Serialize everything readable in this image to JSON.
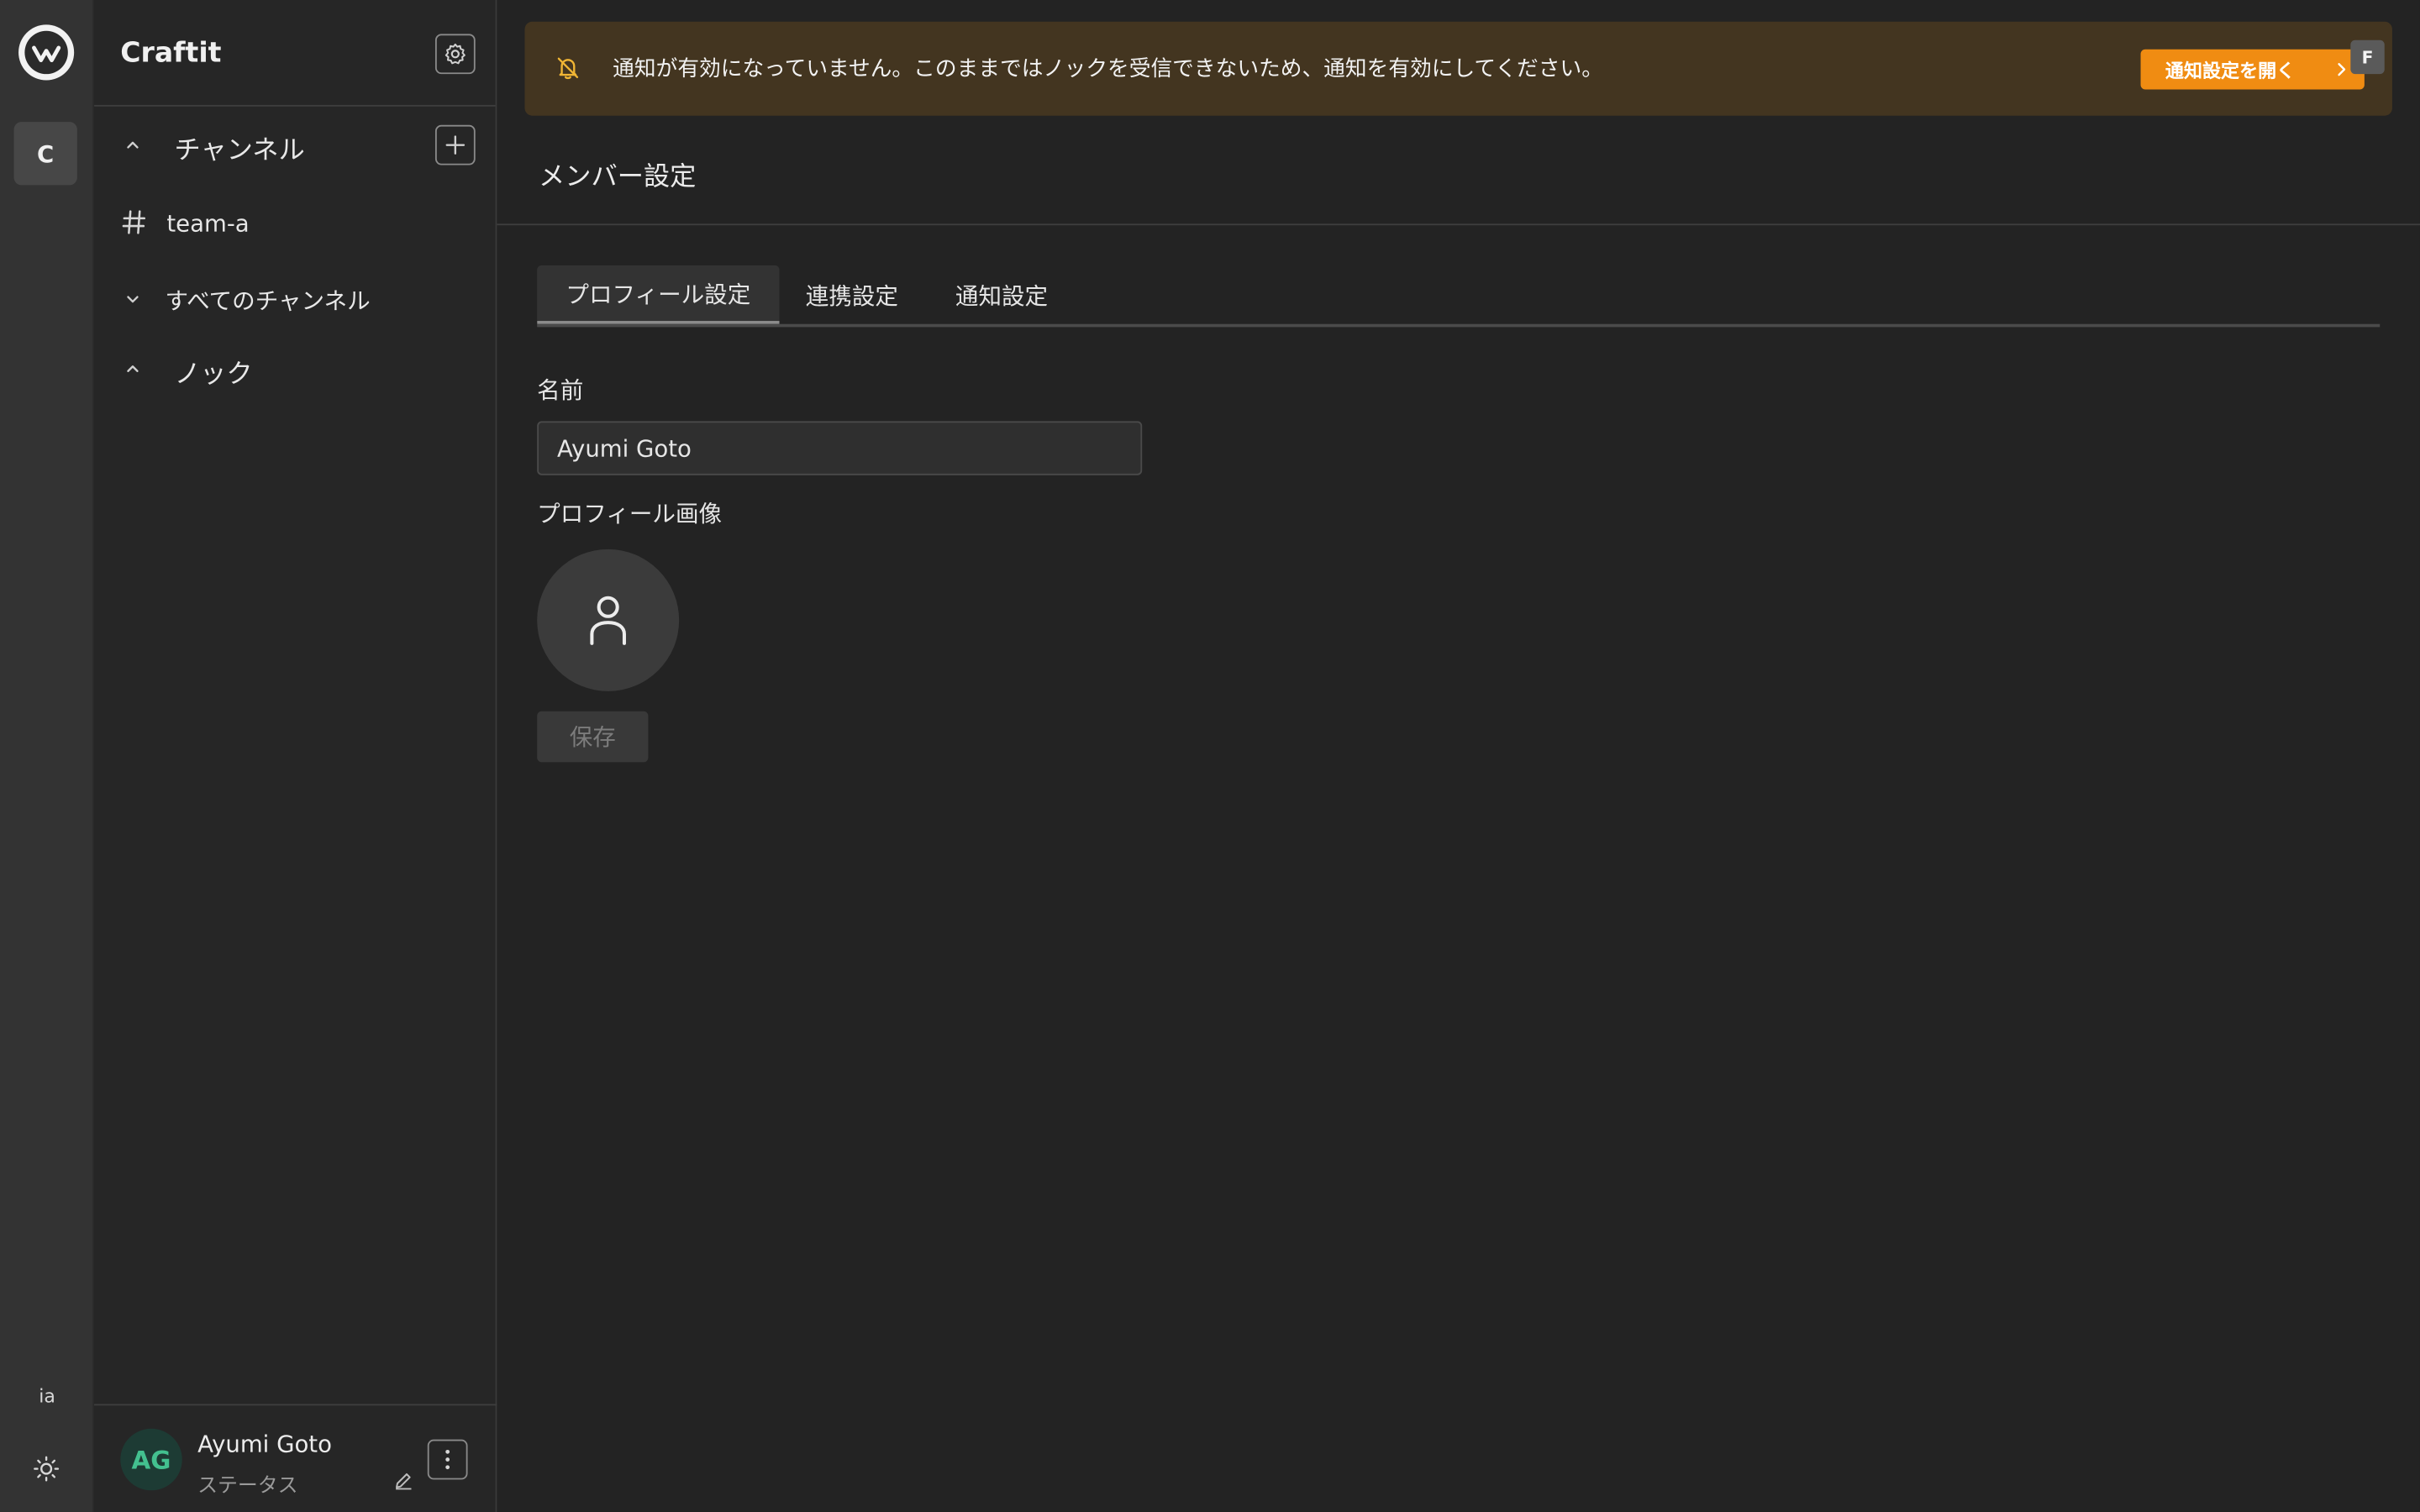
{
  "rail": {
    "workspace_initial": "C",
    "language": "ia"
  },
  "sidebar": {
    "title": "Craftit",
    "sections": {
      "channels_label": "チャンネル",
      "all_channels_label": "すべてのチャンネル",
      "knock_label": "ノック"
    },
    "channels": [
      {
        "name": "team-a"
      }
    ],
    "user": {
      "initials": "AG",
      "name": "Ayumi Goto",
      "status": "ステータス"
    }
  },
  "banner": {
    "message": "通知が有効になっていません。このままではノックを受信できないため、通知を有効にしてください。",
    "button_label": "通知設定を開く",
    "shortcut_key": "F"
  },
  "main": {
    "page_title": "メンバー設定",
    "tabs": [
      {
        "label": "プロフィール設定",
        "active": true
      },
      {
        "label": "連携設定",
        "active": false
      },
      {
        "label": "通知設定",
        "active": false
      }
    ],
    "form": {
      "name_label": "名前",
      "name_value": "Ayumi Goto",
      "image_label": "プロフィール画像",
      "save_label": "保存"
    }
  },
  "colors": {
    "accent": "#f08c12",
    "banner_bg": "#433520",
    "avatar_text": "#43c08f"
  }
}
